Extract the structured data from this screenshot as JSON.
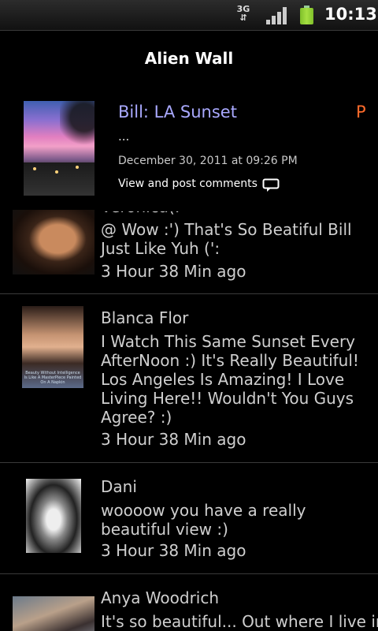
{
  "status_bar": {
    "network": "3G",
    "time": "10:13",
    "icons": [
      "data-arrows-icon",
      "signal-icon",
      "battery-icon"
    ]
  },
  "header": {
    "title": "Alien Wall"
  },
  "post": {
    "title": "Bill: LA Sunset",
    "indicator": "P",
    "excerpt": "...",
    "date": "December 30, 2011 at 09:26 PM",
    "comments_link": "View and post comments",
    "colors": {
      "title": "#a9a9ff",
      "indicator": "#ff6b2b"
    }
  },
  "comments": [
    {
      "name": "Veronica(:",
      "text": "@ Wow :') That's So Beatiful Bill Just Like Yuh (':",
      "time": "3 Hour 38 Min ago"
    },
    {
      "name": "Blanca Flor",
      "text": "I Watch This Same Sunset Every AfterNoon :) It's Really Beautiful! Los Angeles Is Amazing! I Love Living Here!!  Wouldn't You Guys Agree? :)",
      "time": "3 Hour 38 Min ago",
      "avatar_caption": "Beauty Without Intelligence Is Like A MasterPiece Painted On A Napkin"
    },
    {
      "name": "Dani",
      "text": "woooow you have a really beautiful view :)",
      "time": "3 Hour 38 Min ago"
    },
    {
      "name": "Anya Woodrich",
      "text": "It's so beautiful... Out where I live in",
      "time": ""
    }
  ]
}
